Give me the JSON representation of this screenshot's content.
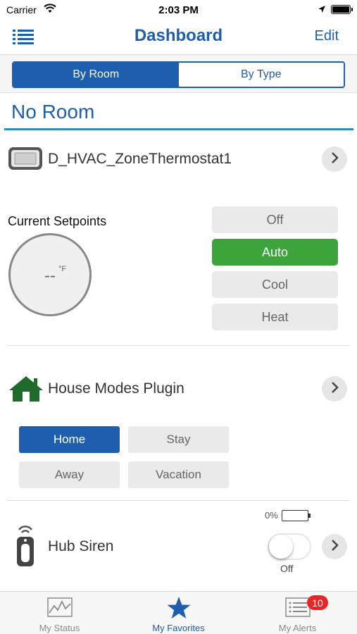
{
  "status_bar": {
    "carrier": "Carrier",
    "time": "2:03 PM"
  },
  "nav": {
    "title": "Dashboard",
    "edit_label": "Edit"
  },
  "segment": {
    "by_room": "By Room",
    "by_type": "By Type",
    "selected": "By Room"
  },
  "room": {
    "title": "No Room"
  },
  "thermostat": {
    "name": "D_HVAC_ZoneThermostat1",
    "setpoints_label": "Current Setpoints",
    "setpoint_value": "--",
    "unit": "°F",
    "modes": [
      "Off",
      "Auto",
      "Cool",
      "Heat"
    ],
    "active_mode": "Auto"
  },
  "house_modes": {
    "name": "House Modes Plugin",
    "modes": [
      "Home",
      "Stay",
      "Away",
      "Vacation"
    ],
    "active_mode": "Home"
  },
  "siren": {
    "name": "Hub Siren",
    "battery": "0%",
    "toggle_state": "Off"
  },
  "tabs": {
    "my_status": "My Status",
    "my_favorites": "My Favorites",
    "my_alerts": "My Alerts",
    "alerts_badge": "10",
    "active": "My Favorites"
  },
  "colors": {
    "brand_blue": "#1e5eae",
    "active_green": "#3ca43a",
    "room_line": "#2a8fbd",
    "badge_red": "#e8262a"
  },
  "icons": {
    "menu": "list-menu-icon",
    "thermostat": "thermostat-icon",
    "house": "house-icon",
    "siren": "siren-remote-icon",
    "chevron": "chevron-right-icon",
    "status": "line-chart-icon",
    "favorites": "star-icon",
    "alerts": "list-icon"
  }
}
